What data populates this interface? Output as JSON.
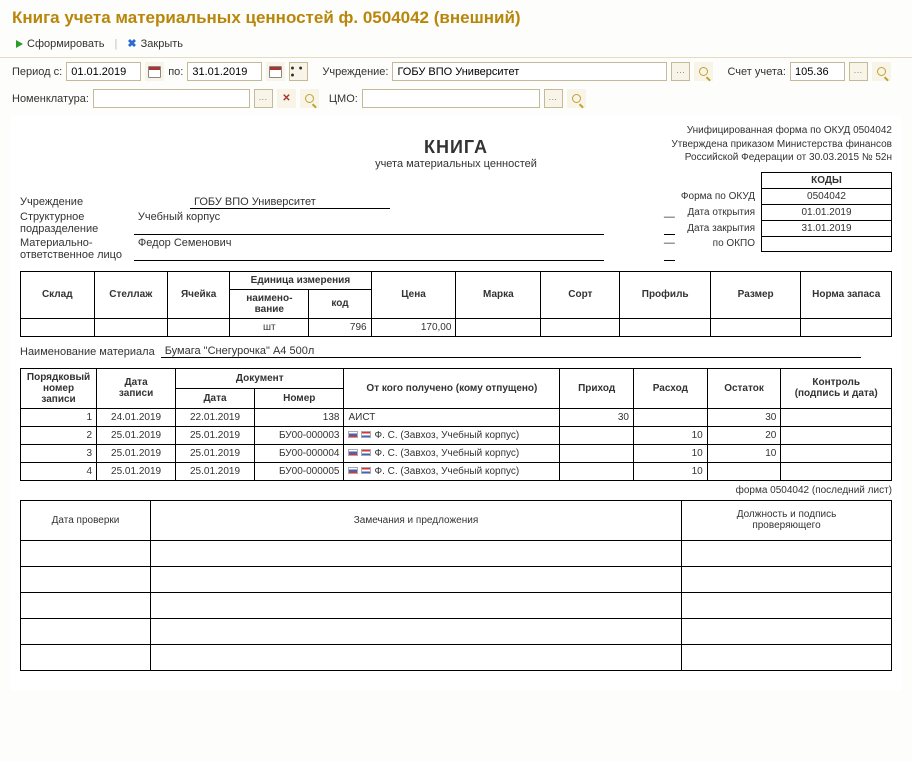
{
  "page_title": "Книга учета материальных ценностей ф. 0504042 (внешний)",
  "toolbar": {
    "generate": "Сформировать",
    "close": "Закрыть"
  },
  "form": {
    "period_from_label": "Период с:",
    "period_from": "01.01.2019",
    "period_to_label": "по:",
    "period_to": "31.01.2019",
    "org_label": "Учреждение:",
    "org": "ГОБУ ВПО Университет",
    "account_label": "Счет учета:",
    "account": "105.36",
    "nomenclature_label": "Номенклатура:",
    "nomenclature": "",
    "cmo_label": "ЦМО:",
    "cmo": ""
  },
  "report_header": {
    "line1": "Унифицированная форма по ОКУД 0504042",
    "line2": "Утверждена приказом Министерства финансов",
    "line3": "Российской Федерации от 30.03.2015 № 52н"
  },
  "book": {
    "title": "КНИГА",
    "subtitle": "учета материальных ценностей"
  },
  "codes": {
    "head": "КОДЫ",
    "okud_label": "Форма по ОКУД",
    "okud": "0504042",
    "open_label": "Дата открытия",
    "open": "01.01.2019",
    "close_label": "Дата закрытия",
    "close": "31.01.2019",
    "okpo_label": "по ОКПО",
    "okpo": ""
  },
  "info": {
    "org_label": "Учреждение",
    "org": "ГОБУ ВПО Университет",
    "dept_label": "Структурное подразделение",
    "dept": "Учебный корпус",
    "mol_label": "Материально-ответственное лицо",
    "mol": "Федор Семенович"
  },
  "grid1_headers": {
    "sklad": "Склад",
    "stellazh": "Стеллаж",
    "yacheyka": "Ячейка",
    "unit": "Единица измерения",
    "unit_name": "наимено-\nвание",
    "unit_code": "код",
    "price": "Цена",
    "marka": "Марка",
    "sort": "Сорт",
    "profile": "Профиль",
    "size": "Размер",
    "norm": "Норма\nзапаса"
  },
  "grid1_row": {
    "unit_name": "шт",
    "unit_code": "796",
    "price": "170,00"
  },
  "material": {
    "label": "Наименование материала",
    "name": "Бумага \"Снегурочка\" А4 500л"
  },
  "grid2_headers": {
    "seq": "Порядковый\nномер\nзаписи",
    "date": "Дата\nзаписи",
    "doc": "Документ",
    "doc_date": "Дата",
    "doc_num": "Номер",
    "from_whom": "От кого получено (кому отпущено)",
    "in": "Приход",
    "out": "Расход",
    "rest": "Остаток",
    "control": "Контроль\n(подпись и дата)"
  },
  "grid2_rows": [
    {
      "n": "1",
      "date": "24.01.2019",
      "ddate": "22.01.2019",
      "dnum": "138",
      "who": "АИСТ",
      "plain": true,
      "in": "30",
      "out": "",
      "rest": "30"
    },
    {
      "n": "2",
      "date": "25.01.2019",
      "ddate": "25.01.2019",
      "dnum": "БУ00-000003",
      "who": "Ф. С. (Завхоз, Учебный корпус)",
      "plain": false,
      "in": "",
      "out": "10",
      "rest": "20"
    },
    {
      "n": "3",
      "date": "25.01.2019",
      "ddate": "25.01.2019",
      "dnum": "БУ00-000004",
      "who": "Ф. С. (Завхоз, Учебный корпус)",
      "plain": false,
      "in": "",
      "out": "10",
      "rest": "10"
    },
    {
      "n": "4",
      "date": "25.01.2019",
      "ddate": "25.01.2019",
      "dnum": "БУ00-000005",
      "who": "Ф. С. (Завхоз, Учебный корпус)",
      "plain": false,
      "in": "",
      "out": "10",
      "rest": ""
    }
  ],
  "last_sheet": "форма 0504042 (последний лист)",
  "check_table": {
    "date_check": "Дата проверки",
    "remarks": "Замечания и предложения",
    "signer": "Должность и подпись\nпроверяющего"
  }
}
